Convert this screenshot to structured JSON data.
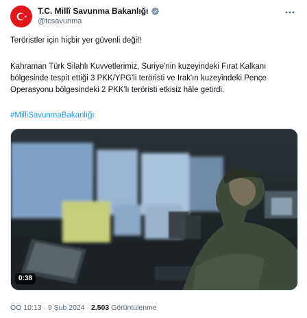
{
  "account": {
    "display_name": "T.C. Millî Savunma Bakanlığı",
    "handle": "@tcsavunma",
    "avatar_icon": "turkish-flag-crescent-icon",
    "verified_icon": "verified-badge-icon"
  },
  "tweet": {
    "line1": "Teröristler için hiçbir yer güvenli değil!",
    "paragraph2_line1": "Kahraman Türk Silahlı Kuvvetlerimiz, Suriye'nin kuzeyindeki Fırat Kalkanı",
    "paragraph2_line2": "bölgesinde tespit ettiği 3 PKK/YPG'li teröristi ve Irak'ın kuzeyindeki Pençe",
    "paragraph2_line3": "Operasyonu bölgesindeki 2 PKK'lı teröristi etkisiz hâle getirdi.",
    "hashtag": "#MilliSavunmaBakanlığı"
  },
  "media": {
    "type": "video",
    "duration": "0:38"
  },
  "meta": {
    "time": "ÖÖ 10:13",
    "separator": " · ",
    "date": "9 Şub 2024",
    "views_count": "2.503",
    "views_label": "Görüntülenme"
  },
  "colors": {
    "accent": "#1d9bf0",
    "brand_red": "#e3161c",
    "secondary_text": "#536471"
  }
}
